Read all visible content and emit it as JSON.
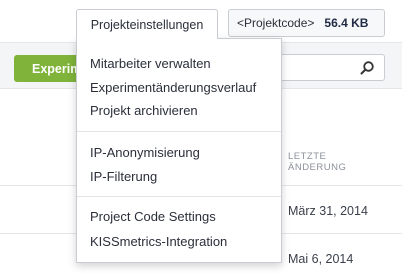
{
  "header": {
    "settings_button": "Projekteinstellungen",
    "code_button": "<Projektcode>",
    "code_size": "56.4 KB"
  },
  "toolbar": {
    "primary_button": "Experim",
    "search_icon": "search-icon"
  },
  "table": {
    "column_header_line1": "LETZTE",
    "column_header_line2": "ÄNDERUNG",
    "rows": [
      {
        "date": "März 31, 2014"
      },
      {
        "date": "Mai 6, 2014"
      }
    ]
  },
  "dropdown": {
    "items": [
      "Mitarbeiter verwalten",
      "Experimentänderungsverlauf",
      "Projekt archivieren",
      "IP-Anonymisierung",
      "IP-Filterung",
      "Project Code Settings",
      "KISSmetrics-Integration"
    ]
  },
  "colors": {
    "accent_green": "#7fb33a",
    "border": "#c9ccd1"
  }
}
